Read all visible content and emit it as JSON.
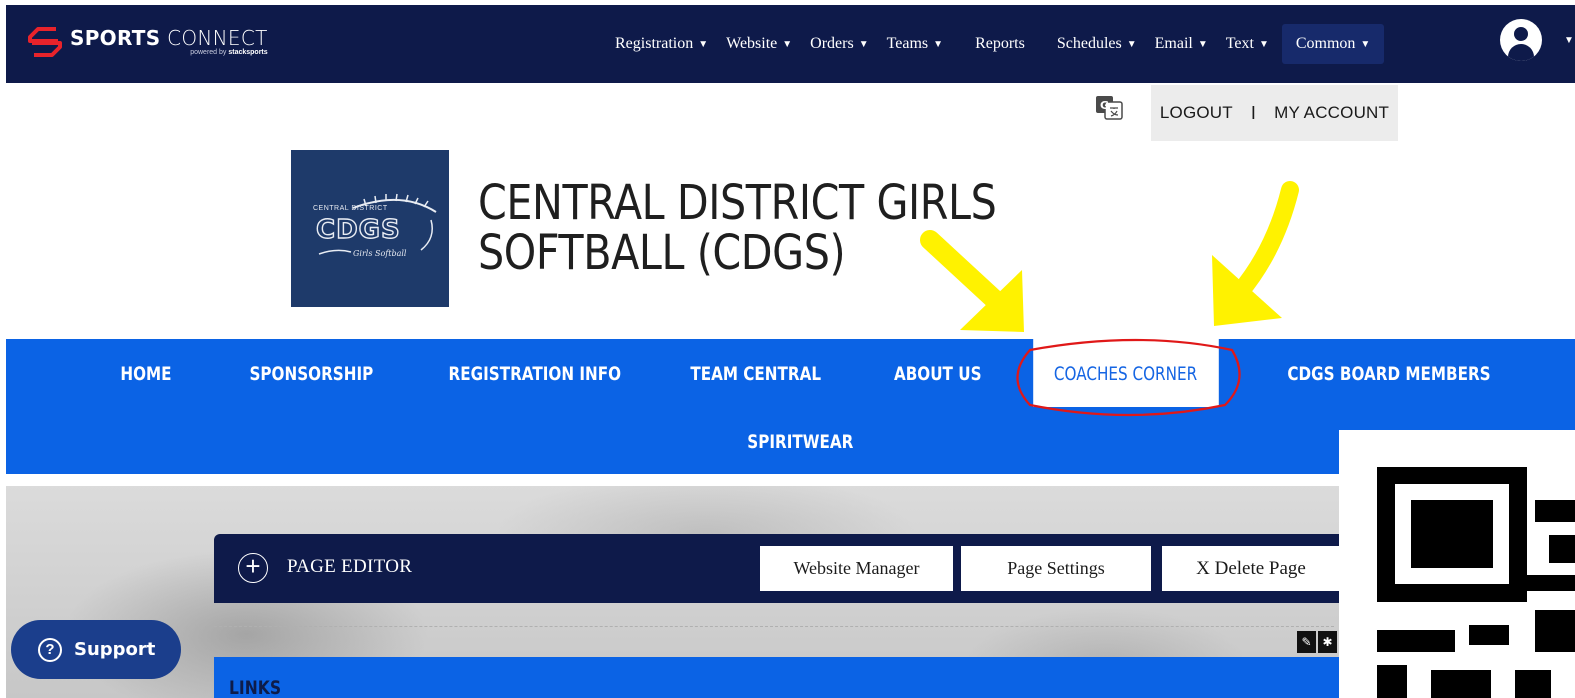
{
  "topbar": {
    "brand_bold": "SPORTS",
    "brand_light": "CONNECT",
    "brand_powered": "powered by",
    "brand_powered_name": "stacksports",
    "nav": [
      {
        "label": "Registration",
        "caret": true
      },
      {
        "label": "Website",
        "caret": true
      },
      {
        "label": "Orders",
        "caret": true
      },
      {
        "label": "Teams",
        "caret": true
      },
      {
        "label": "Reports",
        "caret": false
      },
      {
        "label": "Schedules",
        "caret": true
      },
      {
        "label": "Email",
        "caret": true
      },
      {
        "label": "Text",
        "caret": true
      },
      {
        "label": "Common",
        "caret": true
      }
    ],
    "caret_glyph": "▼"
  },
  "account": {
    "logout": "LOGOUT",
    "separator": "I",
    "my_account": "MY ACCOUNT"
  },
  "header": {
    "logo_line1": "CENTRAL DISTRICT",
    "logo_main": "CDGS",
    "logo_script": "Girls Softball",
    "title": "CENTRAL DISTRICT GIRLS SOFTBALL (CDGS)"
  },
  "main_nav": {
    "items": [
      {
        "label": "HOME"
      },
      {
        "label": "SPONSORSHIP"
      },
      {
        "label": "REGISTRATION INFO"
      },
      {
        "label": "TEAM CENTRAL"
      },
      {
        "label": "ABOUT US"
      },
      {
        "label": "COACHES CORNER",
        "selected": true
      },
      {
        "label": "CDGS BOARD MEMBERS"
      },
      {
        "label": "SPIRITWEAR"
      }
    ]
  },
  "editor": {
    "label": "PAGE EDITOR",
    "buttons": {
      "website_manager": "Website Manager",
      "page_settings": "Page Settings",
      "delete_page": "X Delete Page"
    }
  },
  "links": {
    "title": "LINKS"
  },
  "support": {
    "label": "Support",
    "icon_glyph": "?"
  },
  "colors": {
    "topbar_bg": "#0e1a4a",
    "nav_blue": "#0b63e5",
    "annotation_yellow": "#fff200",
    "annotation_red": "#e01818"
  }
}
